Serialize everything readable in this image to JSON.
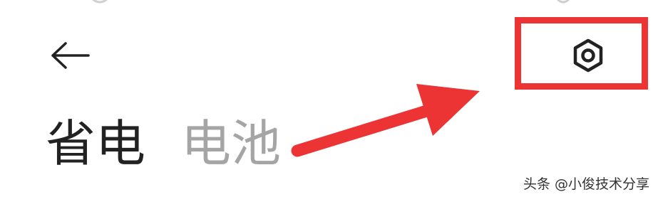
{
  "header": {
    "back_icon": "back-arrow-icon",
    "settings_icon": "hexagon-gear-icon"
  },
  "tabs": [
    {
      "label": "省电",
      "active": true
    },
    {
      "label": "电池",
      "active": false
    }
  ],
  "annotation": {
    "highlight_color": "#ec3434",
    "arrow_color": "#ec3434"
  },
  "watermark": {
    "text": "头条 @小俊技术分享"
  },
  "colors": {
    "active_tab": "#222222",
    "inactive_tab": "#a5a5a5",
    "icon": "#222222"
  }
}
